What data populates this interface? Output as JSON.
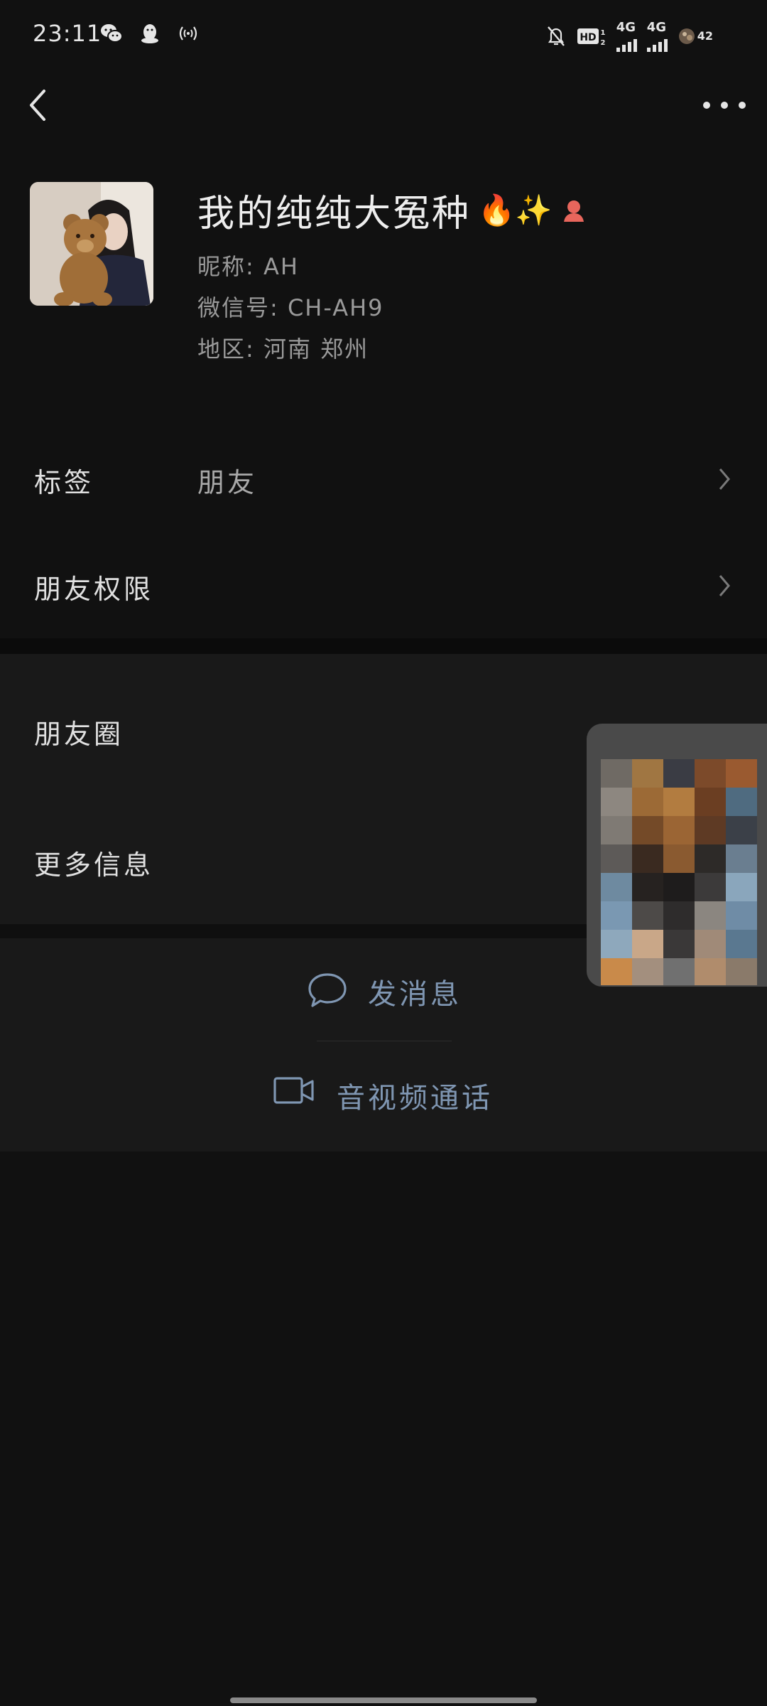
{
  "status_bar": {
    "time": "23:11",
    "battery": "42",
    "net1": "4G",
    "net2": "4G"
  },
  "profile": {
    "name": "我的纯纯大冤种",
    "name_emojis": "🔥✨",
    "nickname_line": "昵称: AH",
    "wechat_id_line": "微信号: CH-AH9",
    "region_line": "地区: 河南 郑州"
  },
  "rows": {
    "tags_label": "标签",
    "tags_value": "朋友",
    "permissions_label": "朋友权限",
    "moments_label": "朋友圈",
    "more_info_label": "更多信息"
  },
  "actions": {
    "send_message": "发消息",
    "video_call": "音视频通话"
  },
  "colors": {
    "background": "#111111",
    "row_background": "#191919",
    "action_text": "#7f96b2",
    "separator": "#0b0b0b"
  },
  "icons": [
    "wechat-icon",
    "qq-icon",
    "nfc-icon",
    "mute-bell-icon",
    "hd-icon",
    "signal-icon",
    "battery-icon",
    "back-arrow-icon",
    "more-dots-icon",
    "chevron-right-icon",
    "chat-bubble-icon",
    "video-camera-icon",
    "contact-avatar-icon"
  ]
}
